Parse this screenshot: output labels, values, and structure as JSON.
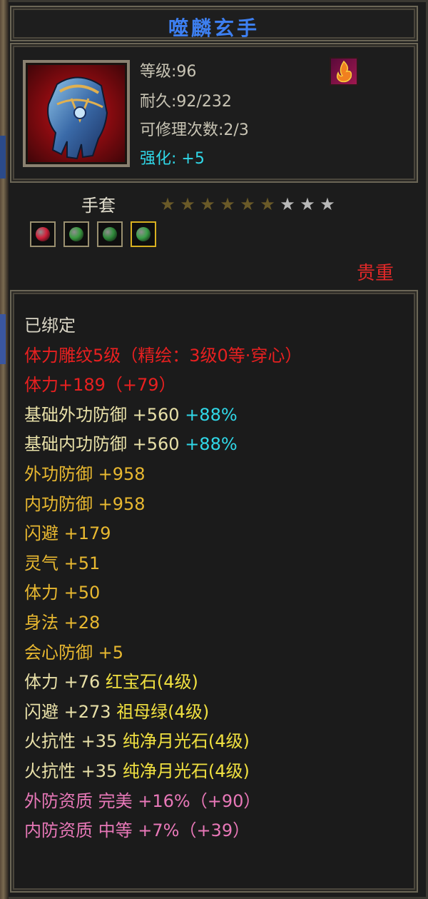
{
  "title": "噬麟玄手",
  "info": {
    "level": "等级:96",
    "durability": "耐久:92/232",
    "repair_count": "可修理次数:2/3",
    "enhance_label": "强化:",
    "enhance_value": "+5",
    "icon_name": "gauntlet-icon",
    "badge_icon": "flame-icon"
  },
  "type": "手套",
  "stars": {
    "filled": 6,
    "total": 9
  },
  "gems": [
    {
      "name": "ruby-gem-icon",
      "color": "#d0203a",
      "selected": false
    },
    {
      "name": "emerald-gem-icon",
      "color": "#3a9a40",
      "selected": false
    },
    {
      "name": "emerald-gem-icon",
      "color": "#2f8a3a",
      "selected": false
    },
    {
      "name": "emerald-gem-icon",
      "color": "#3aa048",
      "selected": true
    }
  ],
  "rarity": "贵重",
  "attributes": [
    {
      "segments": [
        {
          "text": "已绑定",
          "color": "#d8d4c4"
        }
      ]
    },
    {
      "segments": [
        {
          "text": "体力雕纹5级（精绘：3级0等·穿心）",
          "color": "#e82020"
        }
      ]
    },
    {
      "segments": [
        {
          "text": "体力+189（+79）",
          "color": "#e82020"
        }
      ]
    },
    {
      "segments": [
        {
          "text": "基础外功防御 +560 ",
          "color": "#e8e0a8"
        },
        {
          "text": "+88%",
          "color": "#30d8e8"
        }
      ]
    },
    {
      "segments": [
        {
          "text": "基础内功防御 +560 ",
          "color": "#e8e0a8"
        },
        {
          "text": "+88%",
          "color": "#30d8e8"
        }
      ]
    },
    {
      "segments": [
        {
          "text": "外功防御 +958",
          "color": "#e8b830"
        }
      ]
    },
    {
      "segments": [
        {
          "text": "内功防御 +958",
          "color": "#e8b830"
        }
      ]
    },
    {
      "segments": [
        {
          "text": "闪避 +179",
          "color": "#e8b830"
        }
      ]
    },
    {
      "segments": [
        {
          "text": "灵气 +51",
          "color": "#e8b830"
        }
      ]
    },
    {
      "segments": [
        {
          "text": "体力 +50",
          "color": "#e8b830"
        }
      ]
    },
    {
      "segments": [
        {
          "text": "身法 +28",
          "color": "#e8b830"
        }
      ]
    },
    {
      "segments": [
        {
          "text": "会心防御 +5",
          "color": "#e8b830"
        }
      ]
    },
    {
      "segments": [
        {
          "text": "体力 +76 ",
          "color": "#e8e0a8"
        },
        {
          "text": "红宝石(4级)",
          "color": "#f0e040"
        }
      ]
    },
    {
      "segments": [
        {
          "text": "闪避 +273 ",
          "color": "#e8e0a8"
        },
        {
          "text": "祖母绿(4级)",
          "color": "#f0e040"
        }
      ]
    },
    {
      "segments": [
        {
          "text": "火抗性 +35 ",
          "color": "#e8e0a8"
        },
        {
          "text": "纯净月光石(4级)",
          "color": "#f0e040"
        }
      ]
    },
    {
      "segments": [
        {
          "text": "火抗性 +35 ",
          "color": "#e8e0a8"
        },
        {
          "text": "纯净月光石(4级)",
          "color": "#f0e040"
        }
      ]
    },
    {
      "segments": [
        {
          "text": "外防资质  完美 +16%（+90）",
          "color": "#e878b8"
        }
      ]
    },
    {
      "segments": [
        {
          "text": "内防资质  中等 +7%（+39）",
          "color": "#e878b8"
        }
      ]
    }
  ]
}
